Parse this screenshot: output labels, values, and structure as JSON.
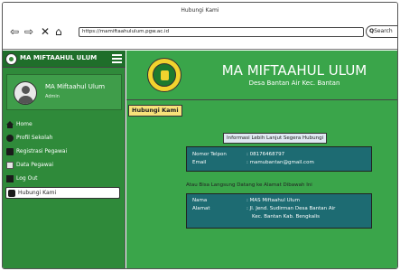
{
  "browser": {
    "window_title": "Hubungi Kami",
    "url": "https://mamiftaahululum.pgw.ac.id",
    "search_placeholder": "Search"
  },
  "sidebar": {
    "brand": "MA MIFTAAHUL ULUM",
    "user": {
      "name": "MA Miftaahul Ulum",
      "role": "Admin"
    },
    "items": [
      {
        "label": "Home",
        "icon": "home-icon"
      },
      {
        "label": "Profil Sekolah",
        "icon": "people-icon"
      },
      {
        "label": "Registrasi Pegawai",
        "icon": "edit-icon"
      },
      {
        "label": "Data Pegawai",
        "icon": "document-icon"
      },
      {
        "label": "Log Out",
        "icon": "logout-icon"
      },
      {
        "label": "Hubungi Kami",
        "icon": "phone-icon",
        "active": true
      }
    ]
  },
  "header": {
    "school_name": "MA MIFTAAHUL ULUM",
    "school_address": "Desa Bantan Air Kec. Bantan"
  },
  "content": {
    "page_badge": "Hubungi Kami",
    "info_button": "Informasi Lebih Lanjut Segera Hubungi",
    "contact": {
      "phone_label": "Nomor Telpon",
      "phone_value": ": 08176468797",
      "email_label": "Email",
      "email_value": ": mamubantan@gmail.com"
    },
    "visit_note": "Atau Bisa Langsung Datang ke Alamat Dibawah Ini",
    "address": {
      "name_label": "Nama",
      "name_value": ": MAS Miftaahul Ulum",
      "addr_label": "Alamat",
      "addr_line1": ": Jl. Jend. Sudirman Desa Bantan Air",
      "addr_line2": "Kec. Bantan Kab. Bengkalis"
    }
  },
  "colors": {
    "green_main": "#3aa54a",
    "green_dark": "#1f6e2a",
    "teal_box": "#1d6b72",
    "badge_yellow": "#f7e27a"
  }
}
